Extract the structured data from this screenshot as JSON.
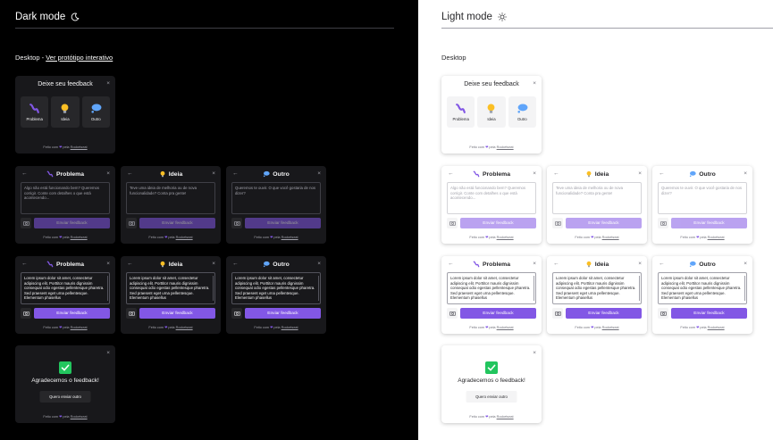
{
  "colors": {
    "brand": "#8257e5",
    "dark_bg": "#000000",
    "dark_card": "#18181b",
    "light_bg": "#ffffff"
  },
  "dark": {
    "title": "Dark mode",
    "subtitle_prefix": "Desktop - ",
    "subtitle_link": "Ver protótipo interativo"
  },
  "light": {
    "title": "Light mode",
    "subtitle": "Desktop"
  },
  "widget": {
    "header": "Deixe seu feedback",
    "close": "×",
    "back": "←",
    "options": [
      {
        "label": "Problema",
        "icon": "problem-icon"
      },
      {
        "label": "Ideia",
        "icon": "bulb-icon"
      },
      {
        "label": "Outro",
        "icon": "thought-bubble-icon"
      }
    ],
    "footer_prefix": "Feito com",
    "footer_mid": "pela",
    "footer_link": "Rocketseat",
    "heart": "❤",
    "placeholders": [
      "Algo não está funcionando bem? Queremos corrigir. Conte com detalhes o que está acontecendo...",
      "Teve uma ideia de melhoria ou de nova funcionalidade? Conta pra gente!",
      "Queremos te ouvir. O que você gostaria de nos dizer?"
    ],
    "filled_text": "Lorem ipsum dolor sit amet, consectetur adipiscing elit. Porttitor mauris dignissim consequat odio egestas pellentesque pharetra. Sed praesent eget urna pellentesque. Elementum phasellus",
    "submit": "Enviar feedback",
    "success": "Agradecemos o feedback!",
    "again": "Quero enviar outro"
  }
}
